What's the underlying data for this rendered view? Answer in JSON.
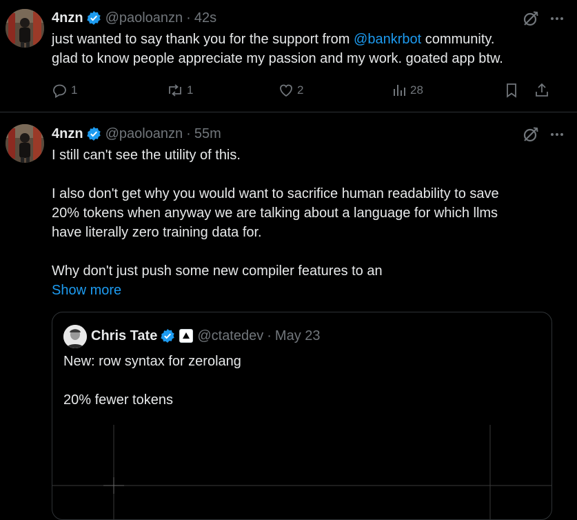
{
  "tweets": [
    {
      "name": "4nzn",
      "handle": "@paoloanzn",
      "separator": "·",
      "time": "42s",
      "text_before_link": "just wanted to say thank you for the support from ",
      "link": "@bankrbot",
      "text_after_link": " community.",
      "text_line2": "glad to know people appreciate my passion and my work. goated app btw.",
      "replies": "1",
      "reposts": "1",
      "likes": "2",
      "views": "28"
    },
    {
      "name": "4nzn",
      "handle": "@paoloanzn",
      "separator": "·",
      "time": "55m",
      "para1": "I still can't see the utility of this.",
      "para2_line1": "I also don't get why you would want to sacrifice human readability to save",
      "para2_line2": "20% tokens when anyway we are talking about a language for which llms",
      "para2_line3": "have literally zero training data for.",
      "para3": "Why don't just push some new compiler features to an",
      "show_more": "Show more",
      "quote": {
        "name": "Chris Tate",
        "handle": "@ctatedev",
        "separator": "·",
        "date": "May 23",
        "line1": "New: row syntax for zerolang",
        "line2": "20% fewer tokens"
      }
    }
  ],
  "colors": {
    "background": "#000000",
    "text": "#e7e9ea",
    "muted": "#71767b",
    "link": "#1d9bf0",
    "verified": "#1d9bf0",
    "border": "#2f3336"
  },
  "icons": [
    "verified-badge-icon",
    "grok-icon",
    "more-icon",
    "reply-icon",
    "repost-icon",
    "like-icon",
    "views-icon",
    "bookmark-icon",
    "share-icon",
    "affiliate-badge-icon"
  ]
}
